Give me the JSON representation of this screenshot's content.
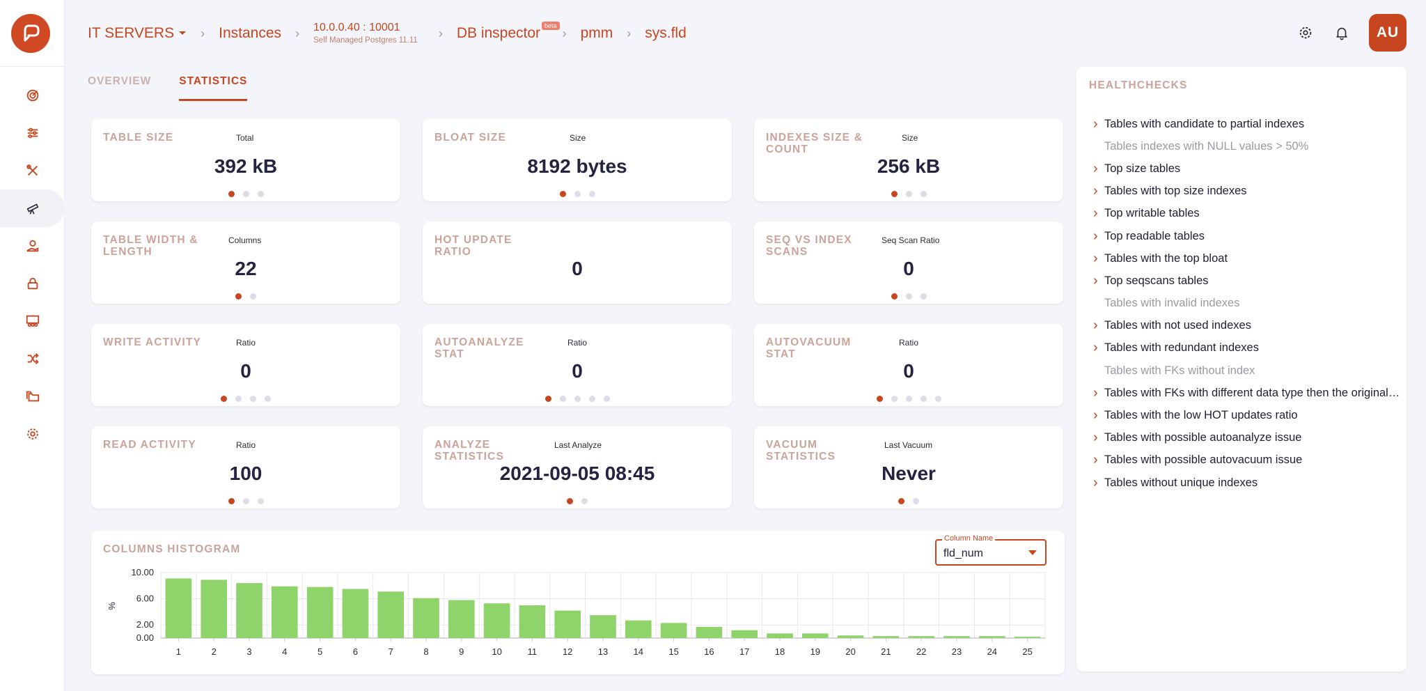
{
  "breadcrumb": {
    "server": "IT SERVERS",
    "instances": "Instances",
    "host": "10.0.0.40 : 10001",
    "host_sub": "Self Managed Postgres 11.11",
    "inspector": "DB inspector",
    "inspector_badge": "beta",
    "database": "pmm",
    "table": "sys.fld"
  },
  "user": {
    "initials": "AU"
  },
  "tabs": [
    {
      "label": "OVERVIEW"
    },
    {
      "label": "STATISTICS"
    }
  ],
  "cards": [
    {
      "title": "TABLE SIZE",
      "sub": "Total",
      "value": "392 kB",
      "dots": 3,
      "active_dot": 0
    },
    {
      "title": "BLOAT SIZE",
      "sub": "Size",
      "value": "8192 bytes",
      "dots": 3,
      "active_dot": 0
    },
    {
      "title": "INDEXES SIZE & COUNT",
      "sub": "Size",
      "value": "256 kB",
      "dots": 3,
      "active_dot": 0
    },
    {
      "title": "TABLE WIDTH & LENGTH",
      "sub": "Columns",
      "value": "22",
      "dots": 2,
      "active_dot": 0
    },
    {
      "title": "HOT UPDATE RATIO",
      "sub": "",
      "value": "0",
      "dots": 0,
      "active_dot": 0
    },
    {
      "title": "SEQ VS INDEX SCANS",
      "sub": "Seq Scan Ratio",
      "value": "0",
      "dots": 3,
      "active_dot": 0
    },
    {
      "title": "WRITE ACTIVITY",
      "sub": "Ratio",
      "value": "0",
      "dots": 4,
      "active_dot": 0
    },
    {
      "title": "AUTOANALYZE STAT",
      "sub": "Ratio",
      "value": "0",
      "dots": 5,
      "active_dot": 0
    },
    {
      "title": "AUTOVACUUM STAT",
      "sub": "Ratio",
      "value": "0",
      "dots": 5,
      "active_dot": 0
    },
    {
      "title": "READ ACTIVITY",
      "sub": "Ratio",
      "value": "100",
      "dots": 3,
      "active_dot": 0
    },
    {
      "title": "ANALYZE STATISTICS",
      "sub": "Last Analyze",
      "value": "2021-09-05 08:45",
      "dots": 2,
      "active_dot": 0
    },
    {
      "title": "VACUUM STATISTICS",
      "sub": "Last Vacuum",
      "value": "Never",
      "dots": 2,
      "active_dot": 0
    }
  ],
  "histogram": {
    "title": "COLUMNS HISTOGRAM",
    "select_label": "Column Name",
    "select_value": "fld_num"
  },
  "chart_data": {
    "type": "bar",
    "title": "",
    "xlabel": "",
    "ylabel": "%",
    "ylim": [
      0,
      10
    ],
    "y_ticks": [
      "10.00",
      "6.00",
      "2.00",
      "0.00"
    ],
    "grid": true,
    "color": "#8fd46a",
    "categories": [
      "1",
      "2",
      "3",
      "4",
      "5",
      "6",
      "7",
      "8",
      "9",
      "10",
      "11",
      "12",
      "13",
      "14",
      "15",
      "16",
      "17",
      "18",
      "19",
      "20",
      "21",
      "22",
      "23",
      "24",
      "25"
    ],
    "values": [
      9.1,
      8.9,
      8.4,
      7.9,
      7.8,
      7.5,
      7.1,
      6.1,
      5.8,
      5.3,
      5.0,
      4.2,
      3.5,
      2.7,
      2.3,
      1.7,
      1.2,
      0.7,
      0.7,
      0.4,
      0.3,
      0.3,
      0.3,
      0.3,
      0.2
    ]
  },
  "healthchecks": {
    "title": "HEALTHCHECKS",
    "items": [
      {
        "label": "Tables with candidate to partial indexes",
        "expandable": true
      },
      {
        "label": "Tables indexes with NULL values > 50%",
        "expandable": false
      },
      {
        "label": "Top size tables",
        "expandable": true
      },
      {
        "label": "Tables with top size indexes",
        "expandable": true
      },
      {
        "label": "Top writable tables",
        "expandable": true
      },
      {
        "label": "Top readable tables",
        "expandable": true
      },
      {
        "label": "Tables with the top bloat",
        "expandable": true
      },
      {
        "label": "Top seqscans tables",
        "expandable": true
      },
      {
        "label": "Tables with invalid indexes",
        "expandable": false
      },
      {
        "label": "Tables with not used indexes",
        "expandable": true
      },
      {
        "label": "Tables with redundant indexes",
        "expandable": true
      },
      {
        "label": "Tables with FKs without index",
        "expandable": false
      },
      {
        "label": "Tables with FKs with different data type then the original…",
        "expandable": true
      },
      {
        "label": "Tables with the low HOT updates ratio",
        "expandable": true
      },
      {
        "label": "Tables with possible autoanalyze issue",
        "expandable": true
      },
      {
        "label": "Tables with possible autovacuum issue",
        "expandable": true
      },
      {
        "label": "Tables without unique indexes",
        "expandable": true
      }
    ]
  },
  "nav": [
    {
      "icon": "dashboard-icon"
    },
    {
      "icon": "sliders-icon"
    },
    {
      "icon": "tools-icon"
    },
    {
      "icon": "telescope-icon",
      "active": true
    },
    {
      "icon": "hand-coin-icon"
    },
    {
      "icon": "lock-icon"
    },
    {
      "icon": "team-icon"
    },
    {
      "icon": "shuffle-icon"
    },
    {
      "icon": "folders-icon"
    },
    {
      "icon": "gear-icon"
    }
  ]
}
